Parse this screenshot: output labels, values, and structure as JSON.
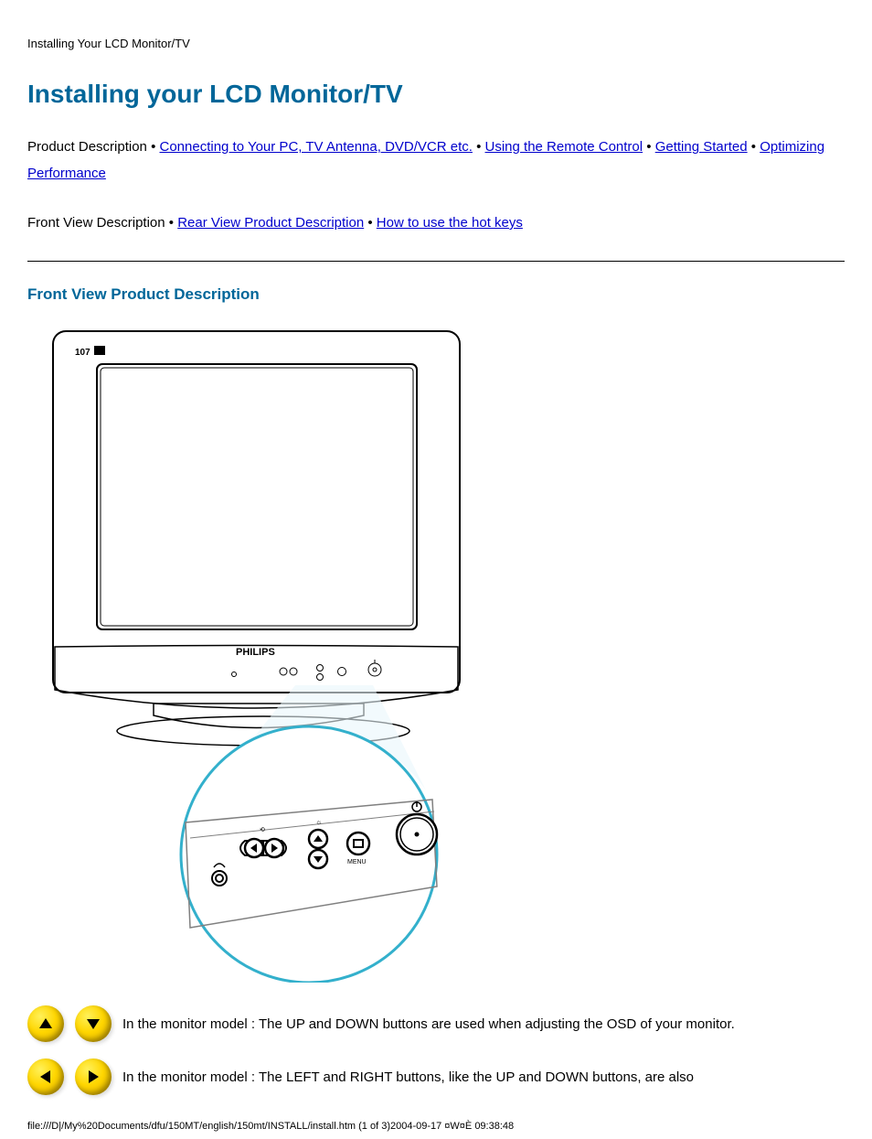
{
  "header": {
    "doc_title": "Installing Your LCD Monitor/TV"
  },
  "title": "Installing your LCD Monitor/TV",
  "nav": {
    "row1": {
      "prefix": "Product Description",
      "links": [
        "Connecting to Your PC, TV Antenna, DVD/VCR etc.",
        "Using the Remote Control",
        "Getting Started",
        "Optimizing Performance"
      ],
      "bullet": " • "
    },
    "row2": {
      "prefix": "Front View Description",
      "links": [
        "Rear View Product Description",
        "How to use the hot keys"
      ],
      "bullet": " • "
    }
  },
  "section": {
    "title": "Front View Product Description"
  },
  "hotkeys": {
    "row1": "In the monitor model : The UP and DOWN buttons are used when adjusting the OSD of your monitor.",
    "row2_prefix": "In the monitor model : The LEFT and RIGHT buttons, like the UP and DOWN buttons, are also"
  },
  "footer": {
    "path": "file:///D|/My%20Documents/dfu/150MT/english/150mt/INSTALL/install.htm (1 of 3)2004-09-17 ¤W¤È 09:38:48"
  }
}
